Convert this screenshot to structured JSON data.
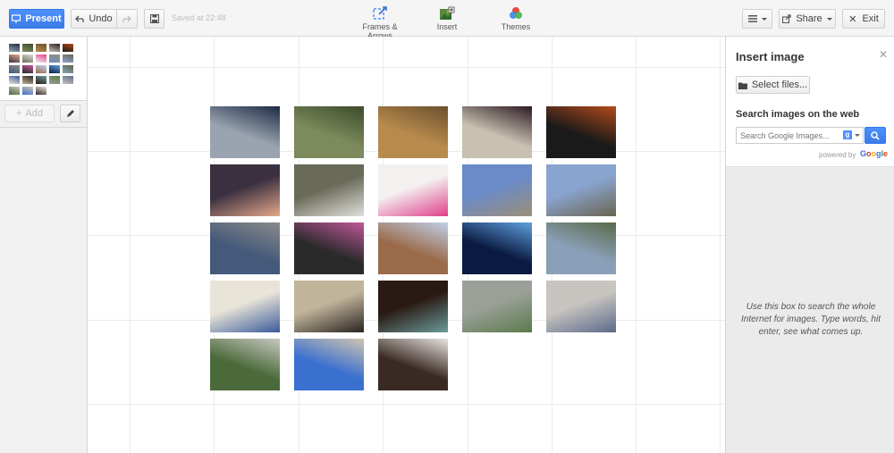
{
  "toolbar": {
    "present_label": "Present",
    "undo_label": "Undo",
    "saved_status": "Saved at 22:48",
    "tools": [
      {
        "label": "Frames & Arrows",
        "icon": "frames-arrows-icon"
      },
      {
        "label": "Insert",
        "icon": "insert-image-icon"
      },
      {
        "label": "Themes",
        "icon": "themes-icon"
      }
    ],
    "share_label": "Share",
    "exit_label": "Exit"
  },
  "left_panel": {
    "add_label": "Add"
  },
  "canvas": {
    "photos": [
      {
        "description": "photo",
        "colors": [
          "#9aa4b0",
          "#1c2a44"
        ]
      },
      {
        "description": "photo",
        "colors": [
          "#7c8a5c",
          "#3c4a2c"
        ]
      },
      {
        "description": "photo",
        "colors": [
          "#b88a4c",
          "#6a5030"
        ]
      },
      {
        "description": "photo",
        "colors": [
          "#c8c0b0",
          "#2a1a22"
        ]
      },
      {
        "description": "photo",
        "colors": [
          "#1a1a1a",
          "#b44a1a"
        ]
      },
      {
        "description": "photo",
        "colors": [
          "#3a3040",
          "#e4a88a"
        ]
      },
      {
        "description": "photo",
        "colors": [
          "#6a6a58",
          "#e0e0dc"
        ]
      },
      {
        "description": "photo",
        "colors": [
          "#f4f0f0",
          "#e0408a"
        ]
      },
      {
        "description": "photo",
        "colors": [
          "#6a8ac8",
          "#9a9078"
        ]
      },
      {
        "description": "photo",
        "colors": [
          "#8aa4d0",
          "#6a6450"
        ]
      },
      {
        "description": "photo",
        "colors": [
          "#445a7a",
          "#8a8a88"
        ]
      },
      {
        "description": "photo",
        "colors": [
          "#2a2a2a",
          "#c0589a"
        ]
      },
      {
        "description": "photo",
        "colors": [
          "#9a6a4a",
          "#c0d0e8"
        ]
      },
      {
        "description": "photo",
        "colors": [
          "#0a1a40",
          "#60a0e0"
        ]
      },
      {
        "description": "photo",
        "colors": [
          "#8aa0b8",
          "#5a6a4a"
        ]
      },
      {
        "description": "photo",
        "colors": [
          "#e8e4d8",
          "#3a5a9a"
        ]
      },
      {
        "description": "photo",
        "colors": [
          "#c0b49a",
          "#2a2420"
        ]
      },
      {
        "description": "photo",
        "colors": [
          "#2a1a14",
          "#6a9a9a"
        ]
      },
      {
        "description": "photo",
        "colors": [
          "#9aa098",
          "#5a7a4a"
        ]
      },
      {
        "description": "photo",
        "colors": [
          "#c8c4c0",
          "#5a6a8a"
        ]
      },
      {
        "description": "photo",
        "colors": [
          "#4a6a3a",
          "#c8c8c0"
        ]
      },
      {
        "description": "photo",
        "colors": [
          "#3a70d0",
          "#d0c4b0"
        ]
      },
      {
        "description": "photo",
        "colors": [
          "#3a2a24",
          "#e8e4e0"
        ]
      }
    ]
  },
  "right_panel": {
    "title": "Insert image",
    "select_files_label": "Select files...",
    "search_heading": "Search images on the web",
    "search_placeholder": "Search Google Images...",
    "powered_by": "powered by",
    "google_logo": "Google",
    "help_text": "Use this box to search the whole Internet for images. Type words, hit enter, see what comes up."
  },
  "colors": {
    "accent_blue": "#4d90fe",
    "panel_bg": "#ebebeb",
    "grid_line": "#ececec"
  }
}
